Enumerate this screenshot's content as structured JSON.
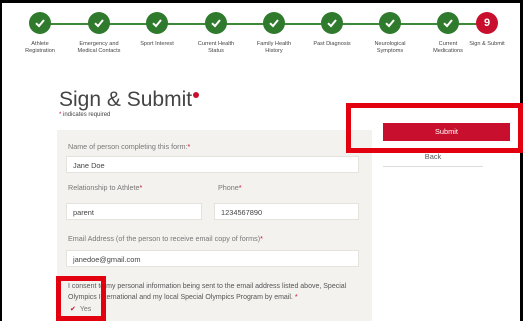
{
  "steps": [
    {
      "label": "Athlete\nRegistration",
      "state": "done"
    },
    {
      "label": "Emergency and\nMedical Contacts",
      "state": "done"
    },
    {
      "label": "Sport Interest",
      "state": "done"
    },
    {
      "label": "Current Health\nStatus",
      "state": "done"
    },
    {
      "label": "Family Health\nHistory",
      "state": "done"
    },
    {
      "label": "Past Diagnosis",
      "state": "done"
    },
    {
      "label": "Neurological\nSymptoms",
      "state": "done"
    },
    {
      "label": "Current\nMedications",
      "state": "done"
    },
    {
      "label": "Sign & Submit",
      "state": "current",
      "number": "9"
    }
  ],
  "page": {
    "title": "Sign & Submit",
    "required_star": "*",
    "required_note": "indicates required"
  },
  "form": {
    "name_label": "Name of person completing this form:",
    "name_value": "Jane Doe",
    "relationship_label": "Relationship to Athlete",
    "relationship_value": "parent",
    "phone_label": "Phone",
    "phone_value": "1234567890",
    "email_label": "Email Address (of the person to receive email copy of forms)",
    "email_value": "janedoe@gmail.com",
    "consent_text": "I consent to my personal information being sent to the email address listed above, Special Olympics International and my local Special Olympics Program by email.",
    "yes_label": "Yes"
  },
  "actions": {
    "submit_label": "Submit",
    "back_label": "Back"
  },
  "colors": {
    "step_done": "#2f7a2c",
    "accent": "#c8102e",
    "annotation": "#e3000f"
  }
}
